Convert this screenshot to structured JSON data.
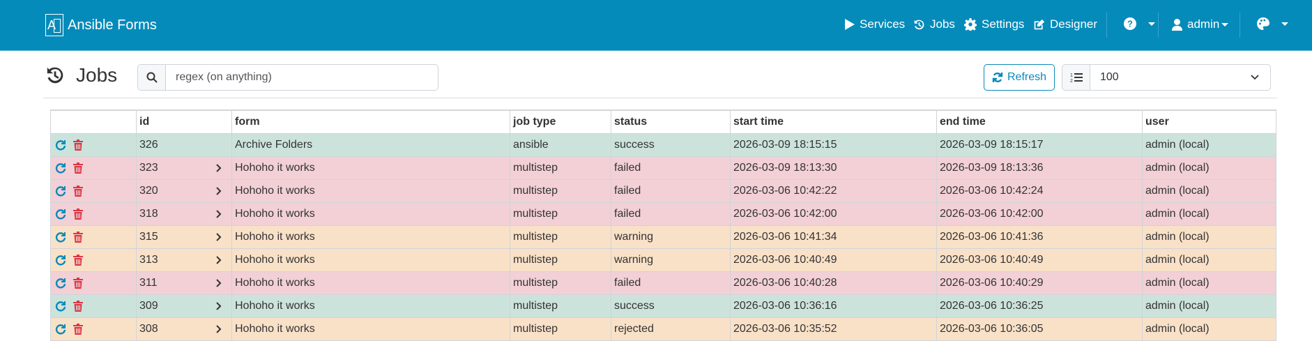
{
  "app": {
    "brand": "Ansible Forms",
    "logo_letter": "A"
  },
  "nav": {
    "items": [
      {
        "label": "Services",
        "icon": "play-icon"
      },
      {
        "label": "Jobs",
        "icon": "history-icon"
      },
      {
        "label": "Settings",
        "icon": "gear-icon"
      },
      {
        "label": "Designer",
        "icon": "edit-icon"
      }
    ],
    "user": "admin"
  },
  "page": {
    "title": "Jobs"
  },
  "search": {
    "placeholder": "regex (on anything)",
    "value": ""
  },
  "toolbar": {
    "refresh_label": "Refresh",
    "page_size": "100"
  },
  "colors": {
    "primary": "#048bba",
    "success_row": "#cce3db",
    "failed_row": "#f2d0d6",
    "warning_row": "#f9e1c8",
    "delete": "#dc3545"
  },
  "table": {
    "headers": [
      "",
      "id",
      "form",
      "job type",
      "status",
      "start time",
      "end time",
      "user"
    ],
    "rows": [
      {
        "id": "326",
        "expandable": false,
        "form": "Archive Folders",
        "job_type": "ansible",
        "status": "success",
        "start": "2026-03-09 18:15:15",
        "end": "2026-03-09 18:15:17",
        "user": "admin (local)"
      },
      {
        "id": "323",
        "expandable": true,
        "form": "Hohoho it works",
        "job_type": "multistep",
        "status": "failed",
        "start": "2026-03-09 18:13:30",
        "end": "2026-03-09 18:13:36",
        "user": "admin (local)"
      },
      {
        "id": "320",
        "expandable": true,
        "form": "Hohoho it works",
        "job_type": "multistep",
        "status": "failed",
        "start": "2026-03-06 10:42:22",
        "end": "2026-03-06 10:42:24",
        "user": "admin (local)"
      },
      {
        "id": "318",
        "expandable": true,
        "form": "Hohoho it works",
        "job_type": "multistep",
        "status": "failed",
        "start": "2026-03-06 10:42:00",
        "end": "2026-03-06 10:42:00",
        "user": "admin (local)"
      },
      {
        "id": "315",
        "expandable": true,
        "form": "Hohoho it works",
        "job_type": "multistep",
        "status": "warning",
        "start": "2026-03-06 10:41:34",
        "end": "2026-03-06 10:41:36",
        "user": "admin (local)"
      },
      {
        "id": "313",
        "expandable": true,
        "form": "Hohoho it works",
        "job_type": "multistep",
        "status": "warning",
        "start": "2026-03-06 10:40:49",
        "end": "2026-03-06 10:40:49",
        "user": "admin (local)"
      },
      {
        "id": "311",
        "expandable": true,
        "form": "Hohoho it works",
        "job_type": "multistep",
        "status": "failed",
        "start": "2026-03-06 10:40:28",
        "end": "2026-03-06 10:40:29",
        "user": "admin (local)"
      },
      {
        "id": "309",
        "expandable": true,
        "form": "Hohoho it works",
        "job_type": "multistep",
        "status": "success",
        "start": "2026-03-06 10:36:16",
        "end": "2026-03-06 10:36:25",
        "user": "admin (local)"
      },
      {
        "id": "308",
        "expandable": true,
        "form": "Hohoho it works",
        "job_type": "multistep",
        "status": "rejected",
        "start": "2026-03-06 10:35:52",
        "end": "2026-03-06 10:36:05",
        "user": "admin (local)"
      }
    ]
  }
}
